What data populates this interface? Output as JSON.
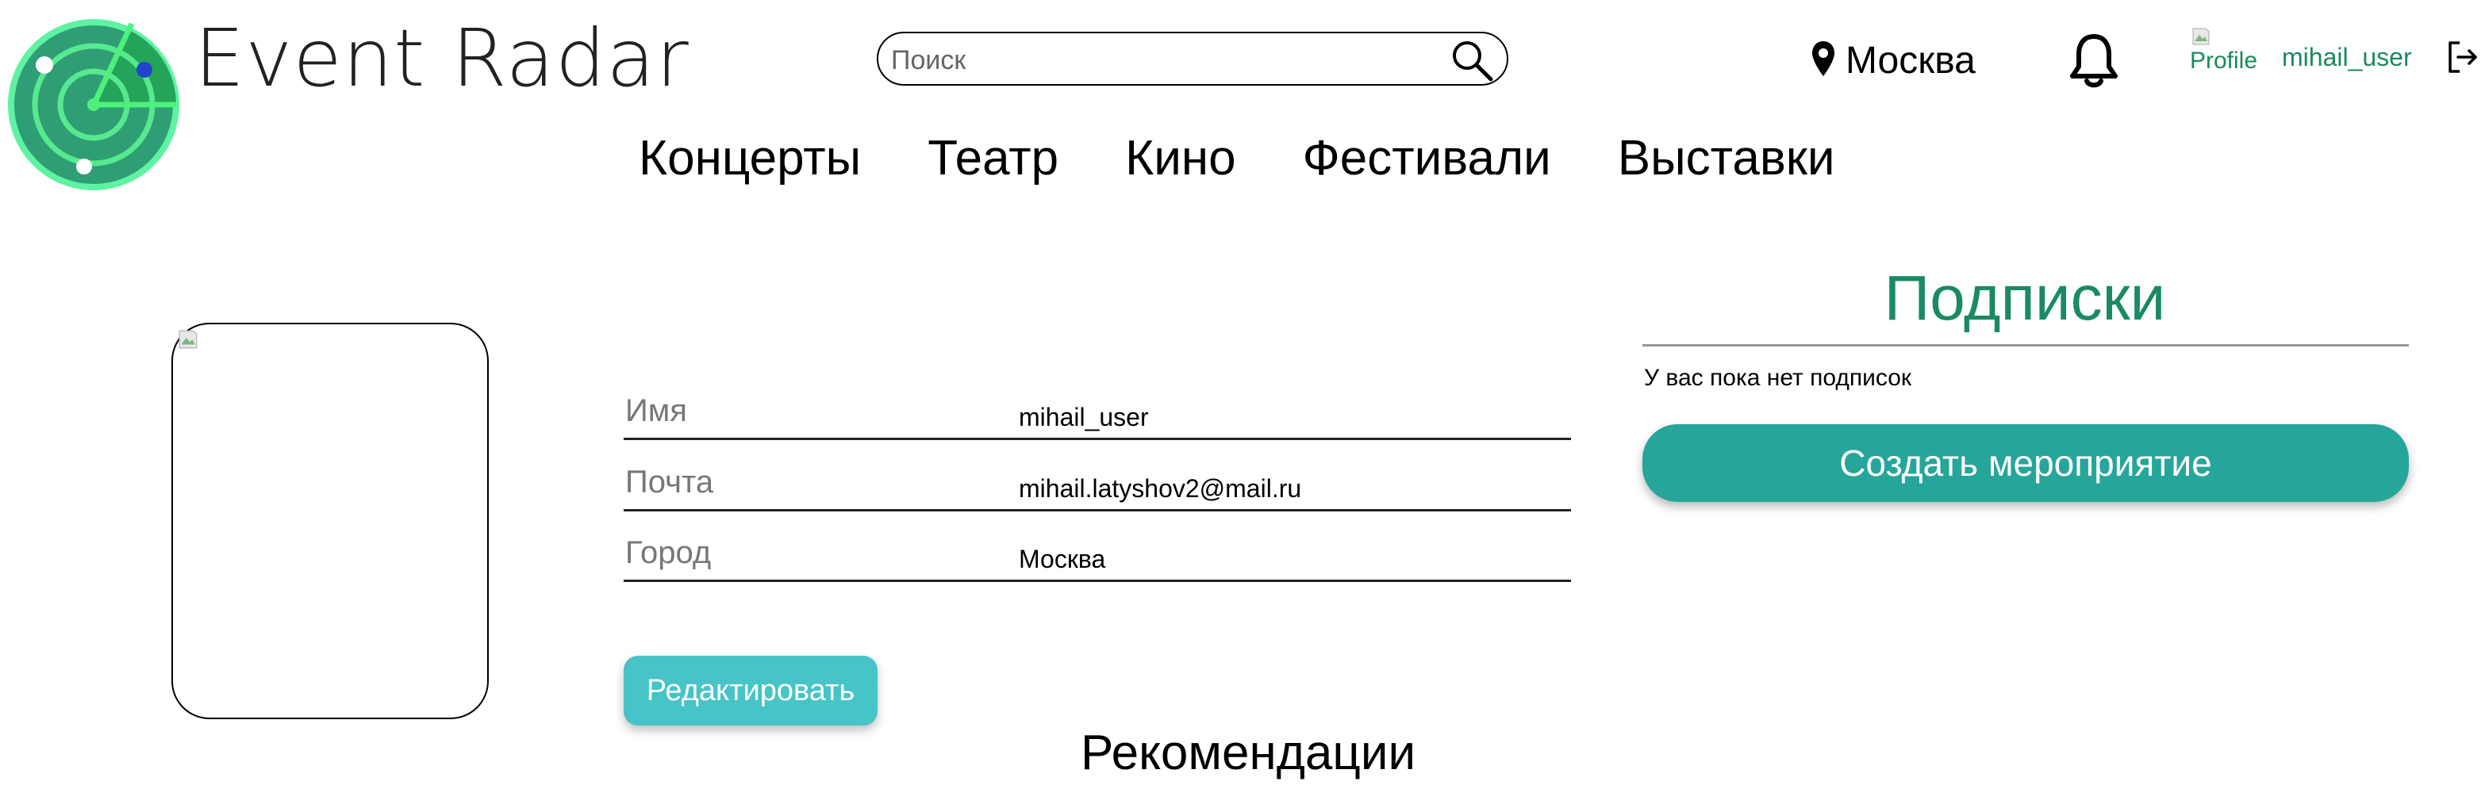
{
  "header": {
    "app_title": "Event Radar",
    "search": {
      "placeholder": "Поиск",
      "value": ""
    },
    "city": "Москва",
    "profile_image_alt": "Profile",
    "username": "mihail_user"
  },
  "nav": {
    "items": [
      {
        "label": "Концерты"
      },
      {
        "label": "Театр"
      },
      {
        "label": "Кино"
      },
      {
        "label": "Фестивали"
      },
      {
        "label": "Выставки"
      }
    ]
  },
  "profile": {
    "fields": [
      {
        "label": "Имя",
        "value": "mihail_user"
      },
      {
        "label": "Почта",
        "value": "mihail.latyshov2@mail.ru"
      },
      {
        "label": "Город",
        "value": "Москва"
      }
    ],
    "edit_button_label": "Редактировать"
  },
  "subscriptions": {
    "title": "Подписки",
    "empty_text": "У вас пока нет подписок",
    "create_button_label": "Создать мероприятие"
  },
  "recommendations": {
    "title": "Рекомендации"
  },
  "colors": {
    "accent_green": "#1a8a66",
    "edit_button": "#46c4c8",
    "create_button": "#26a69a",
    "logo_radar": "#2ecc71"
  },
  "icons": {
    "logo": "radar-logo",
    "search": "search-icon",
    "location": "map-pin-icon",
    "notifications": "bell-icon",
    "logout": "logout-icon"
  }
}
